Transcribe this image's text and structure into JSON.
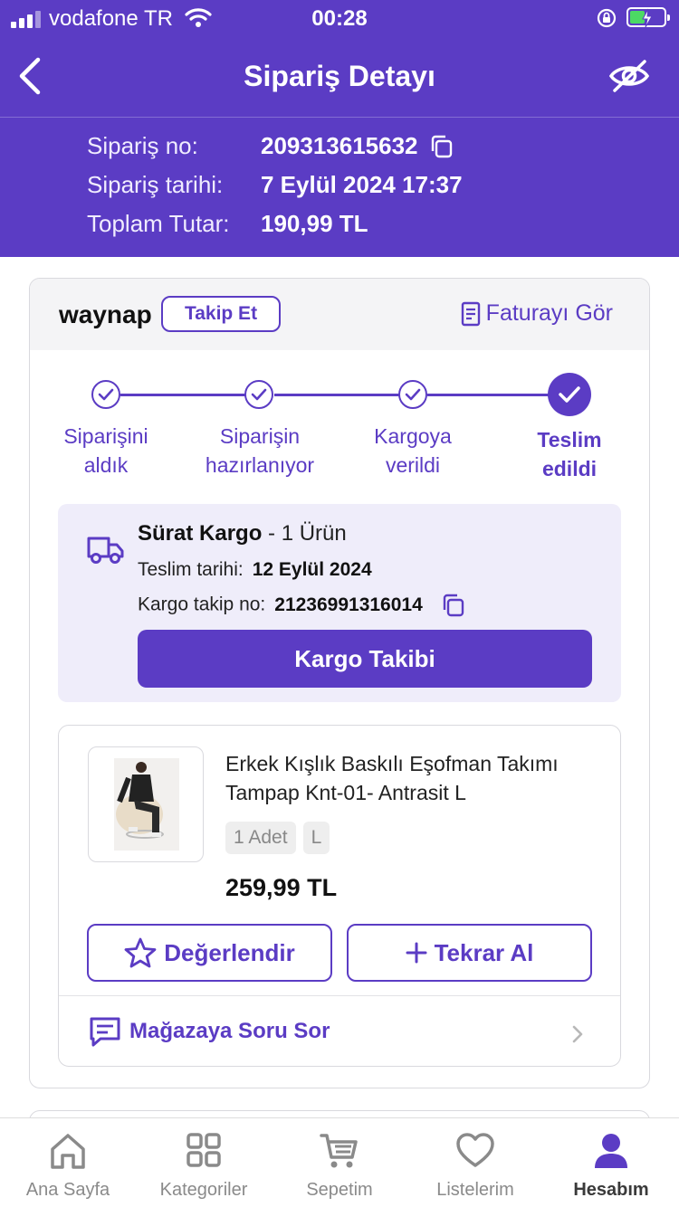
{
  "status_bar": {
    "carrier": "vodafone TR",
    "time": "00:28"
  },
  "nav": {
    "title": "Sipariş Detayı"
  },
  "order": {
    "no_label": "Sipariş no:",
    "no": "209313615632",
    "date_label": "Sipariş tarihi:",
    "date": "7 Eylül 2024 17:37",
    "total_label": "Toplam Tutar:",
    "total": "190,99 TL"
  },
  "seller": {
    "name": "waynap",
    "follow_label": "Takip Et",
    "invoice_label": "Faturayı Gör"
  },
  "steps": [
    {
      "line1": "Siparişini",
      "line2": "aldık"
    },
    {
      "line1": "Siparişin",
      "line2": "hazırlanıyor"
    },
    {
      "line1": "Kargoya",
      "line2": "verildi"
    },
    {
      "line1": "Teslim",
      "line2": "edildi"
    }
  ],
  "shipment": {
    "carrier": "Sürat Kargo",
    "items": "- 1 Ürün",
    "delivery_label": "Teslim tarihi:",
    "delivery_date": "12 Eylül 2024",
    "tracking_label": "Kargo takip no:",
    "tracking_no": "21236991316014",
    "track_button": "Kargo Takibi"
  },
  "product": {
    "name": "Erkek Kışlık Baskılı Eşofman Takımı Tampap Knt-01- Antrasit L",
    "qty": "1 Adet",
    "size": "L",
    "price": "259,99 TL",
    "rate_label": "Değerlendir",
    "rebuy_label": "Tekrar Al",
    "ask_label": "Mağazaya Soru Sor"
  },
  "tabs": [
    {
      "label": "Ana Sayfa",
      "icon": "home-icon"
    },
    {
      "label": "Kategoriler",
      "icon": "grid-icon"
    },
    {
      "label": "Sepetim",
      "icon": "cart-icon"
    },
    {
      "label": "Listelerim",
      "icon": "heart-icon"
    },
    {
      "label": "Hesabım",
      "icon": "user-icon",
      "active": true
    }
  ],
  "colors": {
    "brand": "#5b3cc4",
    "light_panel": "#efedfa",
    "battery": "#4cd964"
  }
}
